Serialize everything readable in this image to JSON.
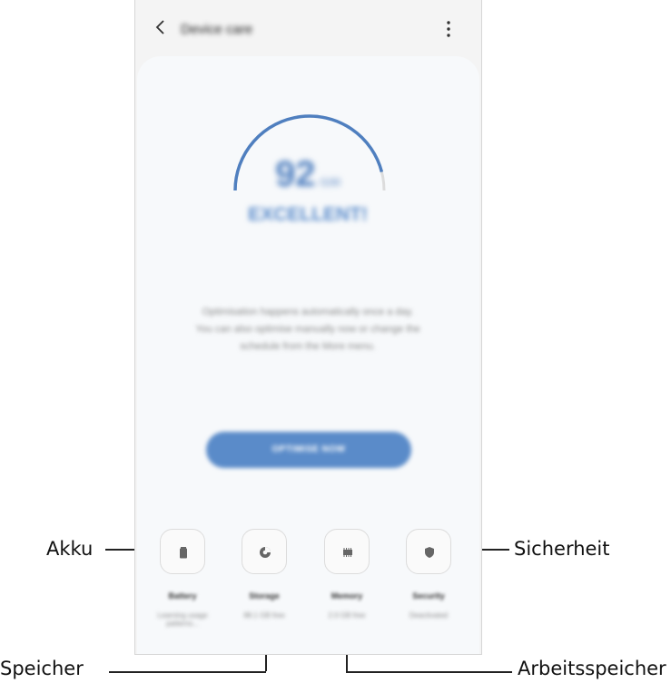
{
  "app": {
    "title": "Device care"
  },
  "score": {
    "value": "92",
    "out_of": "/100",
    "gauge_fraction": 0.92,
    "rating": "EXCELLENT!"
  },
  "description": {
    "line1": "Optimisation happens automatically once a day.",
    "line2": "You can also optimise manually now or change the",
    "line3": "schedule from the More menu."
  },
  "optimize_button": "OPTIMISE NOW",
  "categories": [
    {
      "label": "Battery",
      "sub": "Learning usage patterns...",
      "icon": "battery-icon"
    },
    {
      "label": "Storage",
      "sub": "88.1 GB free",
      "icon": "storage-pie-icon"
    },
    {
      "label": "Memory",
      "sub": "2.0 GB free",
      "icon": "memory-chip-icon"
    },
    {
      "label": "Security",
      "sub": "Deactivated",
      "icon": "shield-icon"
    }
  ],
  "callouts": {
    "akku": "Akku",
    "speicher": "Speicher",
    "arbeitsspeicher": "Arbeitsspeicher",
    "sicherheit": "Sicherheit"
  },
  "colors": {
    "accent": "#5a8bc9",
    "gauge_track": "#dcdcdc",
    "background": "#f4f4f4"
  }
}
